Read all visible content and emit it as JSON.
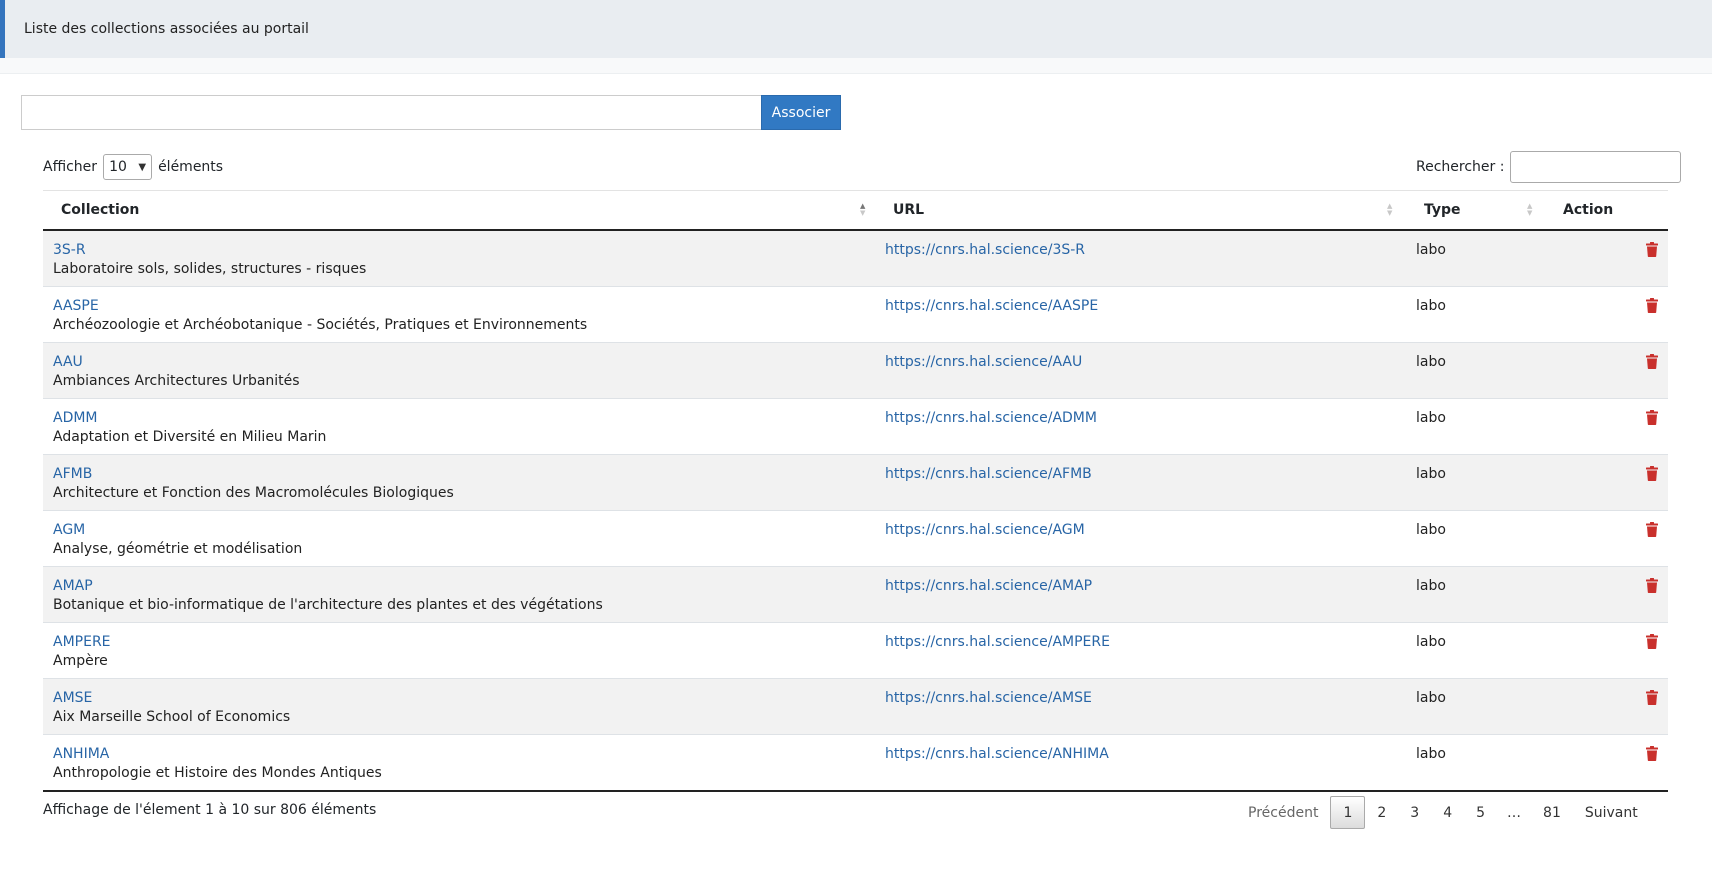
{
  "panel": {
    "title": "Liste des collections associées au portail"
  },
  "associate": {
    "input_value": "",
    "button_label": "Associer"
  },
  "length": {
    "prefix": "Afficher",
    "value": "10",
    "suffix": "éléments"
  },
  "search": {
    "label": "Rechercher :",
    "value": ""
  },
  "table": {
    "headers": {
      "collection": "Collection",
      "url": "URL",
      "type": "Type",
      "action": "Action"
    },
    "rows": [
      {
        "code": "3S-R",
        "name": "Laboratoire sols, solides, structures - risques",
        "url": "https://cnrs.hal.science/3S-R",
        "type": "labo"
      },
      {
        "code": "AASPE",
        "name": "Archéozoologie et Archéobotanique - Sociétés, Pratiques et Environnements",
        "url": "https://cnrs.hal.science/AASPE",
        "type": "labo"
      },
      {
        "code": "AAU",
        "name": "Ambiances Architectures Urbanités",
        "url": "https://cnrs.hal.science/AAU",
        "type": "labo"
      },
      {
        "code": "ADMM",
        "name": "Adaptation et Diversité en Milieu Marin",
        "url": "https://cnrs.hal.science/ADMM",
        "type": "labo"
      },
      {
        "code": "AFMB",
        "name": "Architecture et Fonction des Macromolécules Biologiques",
        "url": "https://cnrs.hal.science/AFMB",
        "type": "labo"
      },
      {
        "code": "AGM",
        "name": "Analyse, géométrie et modélisation",
        "url": "https://cnrs.hal.science/AGM",
        "type": "labo"
      },
      {
        "code": "AMAP",
        "name": "Botanique et bio-informatique de l'architecture des plantes et des végétations",
        "url": "https://cnrs.hal.science/AMAP",
        "type": "labo"
      },
      {
        "code": "AMPERE",
        "name": "Ampère",
        "url": "https://cnrs.hal.science/AMPERE",
        "type": "labo"
      },
      {
        "code": "AMSE",
        "name": "Aix Marseille School of Economics",
        "url": "https://cnrs.hal.science/AMSE",
        "type": "labo"
      },
      {
        "code": "ANHIMA",
        "name": "Anthropologie et Histoire des Mondes Antiques",
        "url": "https://cnrs.hal.science/ANHIMA",
        "type": "labo"
      }
    ]
  },
  "info": "Affichage de l'élement 1 à 10 sur 806 éléments",
  "pagination": {
    "previous": "Précédent",
    "pages": [
      "1",
      "2",
      "3",
      "4",
      "5"
    ],
    "ellipsis": "…",
    "last": "81",
    "next": "Suivant"
  },
  "colors": {
    "accent": "#3179c3",
    "link": "#2865a6",
    "delete": "#c9302c"
  },
  "icons": {
    "delete": "trash-icon",
    "sort": "sort-icon",
    "dropdown": "chevron-down-icon"
  }
}
